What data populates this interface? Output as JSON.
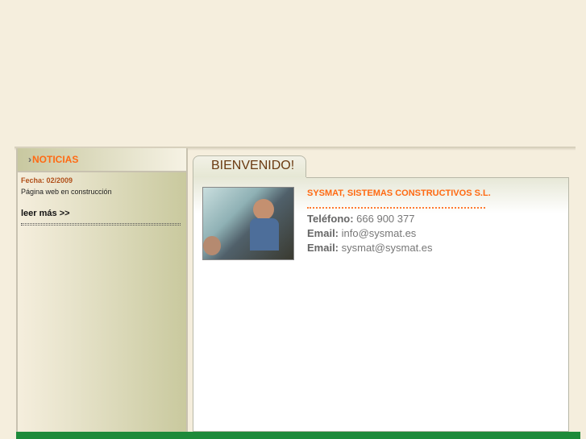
{
  "sidebar": {
    "title": "NOTICIAS",
    "news": {
      "date": "Fecha: 02/2009",
      "text": "Página web en construcción",
      "more": "leer más >>"
    }
  },
  "main": {
    "tab": "BIENVENIDO!",
    "company": "SYSMAT, SISTEMAS CONSTRUCTIVOS S.L.",
    "contacts": [
      {
        "label": "Teléfono:",
        "value": "666 900 377"
      },
      {
        "label": "Email:",
        "value": "info@sysmat.es"
      },
      {
        "label": "Email:",
        "value": "sysmat@sysmat.es"
      }
    ]
  },
  "colors": {
    "accent": "#ff6a13",
    "footer": "#1e8a3a",
    "background": "#f5eedd"
  }
}
